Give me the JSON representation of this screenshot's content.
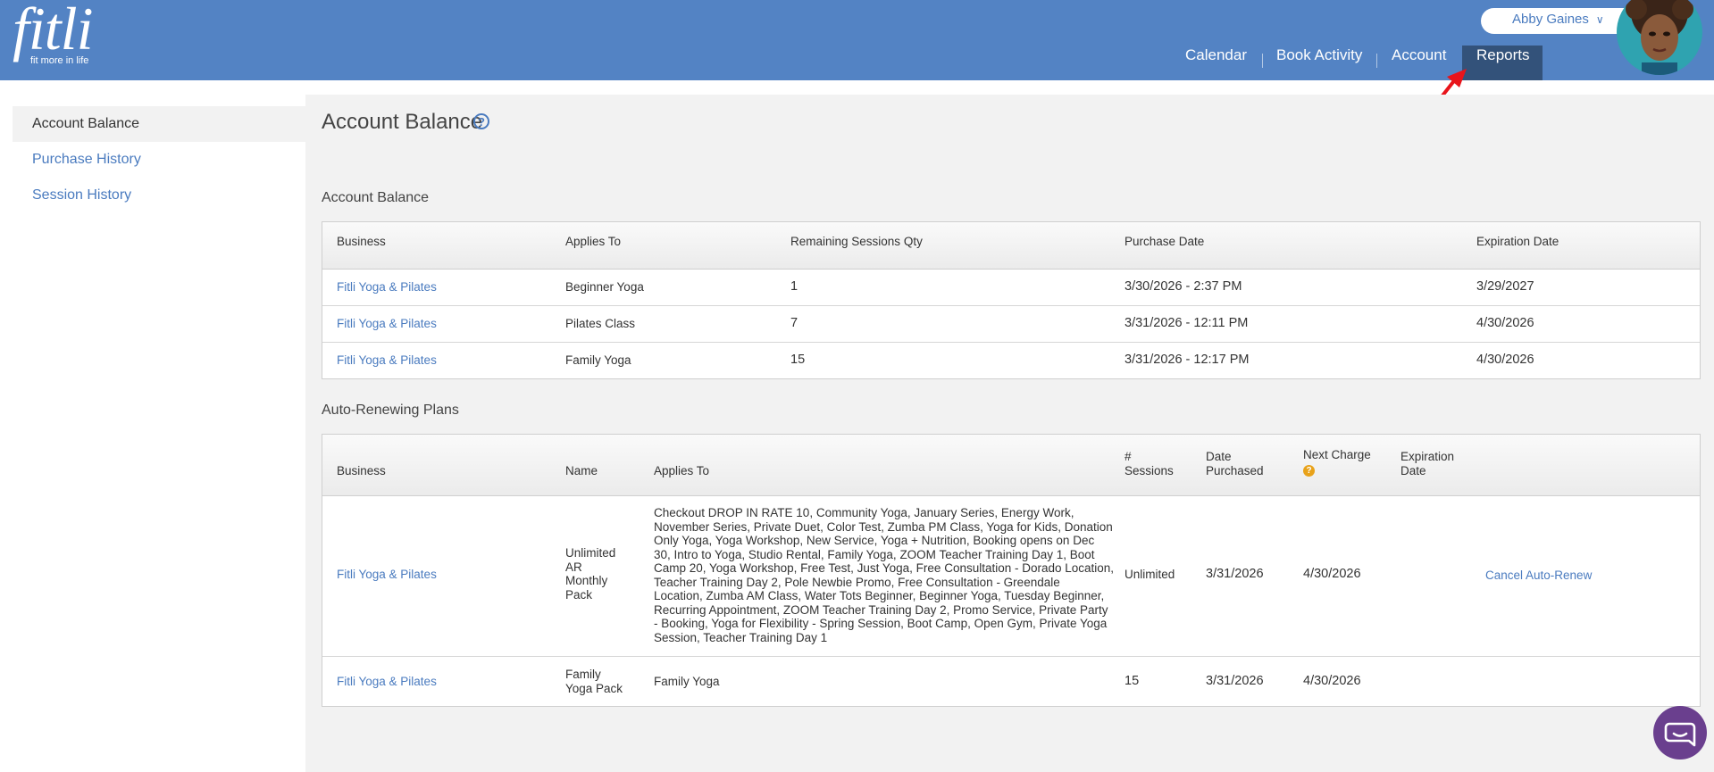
{
  "app": {
    "logo": "fitli",
    "tagline": "fit more in life",
    "user_name": "Abby Gaines"
  },
  "nav": [
    "Calendar",
    "Book Activity",
    "Account",
    "Reports"
  ],
  "sidebar": [
    "Account Balance",
    "Purchase History",
    "Session History"
  ],
  "page": {
    "title": "Account Balance"
  },
  "balance": {
    "title": "Account Balance",
    "headers": [
      "Business",
      "Applies To",
      "Remaining Sessions Qty",
      "Purchase Date",
      "Expiration Date"
    ],
    "rows": [
      [
        "Fitli Yoga & Pilates",
        "Beginner Yoga",
        "1",
        "3/30/2026 - 2:37 PM",
        "3/29/2027"
      ],
      [
        "Fitli Yoga & Pilates",
        "Pilates Class",
        "7",
        "3/31/2026 - 12:11 PM",
        "4/30/2026"
      ],
      [
        "Fitli Yoga & Pilates",
        "Family Yoga",
        "15",
        "3/31/2026 - 12:17 PM",
        "4/30/2026"
      ]
    ]
  },
  "plans": {
    "title": "Auto-Renewing Plans",
    "headers": {
      "business": "Business",
      "name": "Name",
      "applies_to": "Applies To",
      "sessions": [
        "#",
        "Sessions"
      ],
      "date_purchased": [
        "Date",
        "Purchased"
      ],
      "next_charge": "Next Charge",
      "expiration": [
        "Expiration",
        "Date"
      ]
    },
    "rows": [
      {
        "business": "Fitli Yoga & Pilates",
        "name": [
          "Unlimited",
          "AR",
          "Monthly",
          "Pack"
        ],
        "applies_to": [
          "Checkout DROP IN RATE 10, Community Yoga, January Series, Energy Work,",
          "November Series, Private Duet, Color Test, Zumba PM Class, Yoga for Kids, Donation",
          "Only Yoga, Yoga Workshop, New Service, Yoga + Nutrition, Booking opens on Dec",
          "30, Intro to Yoga, Studio Rental, Family Yoga, ZOOM Teacher Training Day 1, Boot",
          "Camp 20, Yoga Workshop, Free Test, Just Yoga, Free Consultation - Dorado Location,",
          "Teacher Training Day 2, Pole Newbie Promo, Free Consultation - Greendale",
          "Location, Zumba AM Class, Water Tots Beginner, Beginner Yoga, Tuesday Beginner,",
          "Recurring Appointment, ZOOM Teacher Training Day 2, Promo Service, Private Party",
          "- Booking, Yoga for Flexibility - Spring Session, Boot Camp, Open Gym, Private Yoga",
          "Session, Teacher Training Day 1"
        ],
        "sessions": "Unlimited",
        "date_purchased": "3/31/2026",
        "next_charge": "4/30/2026",
        "expiration": "",
        "action": "Cancel Auto-Renew"
      },
      {
        "business": "Fitli Yoga & Pilates",
        "name": [
          "Family",
          "Yoga Pack"
        ],
        "applies_to": [
          "Family Yoga"
        ],
        "sessions": "15",
        "date_purchased": "3/31/2026",
        "next_charge": "4/30/2026",
        "expiration": "",
        "action": ""
      }
    ]
  },
  "colors": {
    "header": "#5383c4",
    "active_tab": "#33527a",
    "link": "#4a7bbf",
    "chat": "#6a3f8e",
    "annotation_arrow": "#e8141b"
  }
}
